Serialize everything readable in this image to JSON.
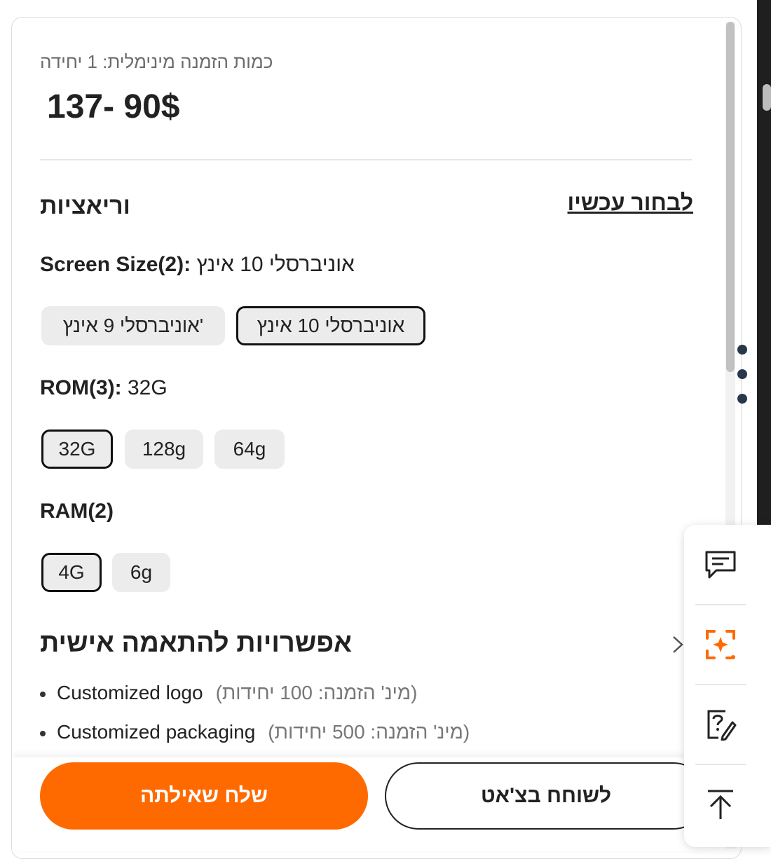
{
  "product": {
    "min_order": "כמות הזמנה מינימלית: 1 יחידה",
    "price_range": "137- 90$"
  },
  "variations": {
    "title": "וריאציות",
    "choose_now": "לבחור עכשיו",
    "screen_size": {
      "label": "Screen Size(2):",
      "selected": "אוניברסלי 10 אינץ",
      "options": [
        "אוניברסלי 10 אינץ",
        "'אוניברסלי 9 אינץ"
      ]
    },
    "rom": {
      "label": "ROM(3):",
      "selected": "32G",
      "options": [
        "32G",
        "128g",
        "64g"
      ]
    },
    "ram": {
      "label": "RAM(2)",
      "options": [
        "4G",
        "6g"
      ]
    }
  },
  "customization": {
    "title": "אפשרויות להתאמה אישית",
    "items": [
      {
        "name": "Customized logo",
        "note": "(מינ' הזמנה: 100 יחידות)"
      },
      {
        "name": "Customized packaging",
        "note": "(מינ' הזמנה: 500 יחידות)"
      }
    ]
  },
  "actions": {
    "send_inquiry": "שלח שאילתה",
    "chat_now": "לשוחח בצ'אט"
  },
  "side_tools": [
    "message-icon",
    "ai-search-icon",
    "help-edit-icon",
    "back-to-top-icon"
  ],
  "colors": {
    "accent": "#ff6a00",
    "dots": "#27384a"
  }
}
